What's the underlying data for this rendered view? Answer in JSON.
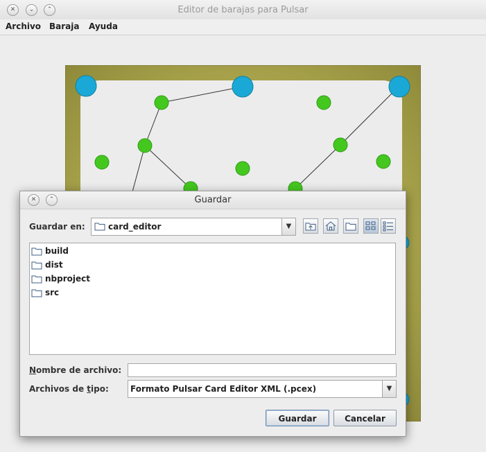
{
  "window": {
    "title": "Editor de barajas para Pulsar",
    "controls": [
      "close-icon",
      "minimize-icon",
      "maximize-icon"
    ]
  },
  "menubar": {
    "items": [
      {
        "label": "Archivo"
      },
      {
        "label": "Baraja"
      },
      {
        "label": "Ayuda"
      }
    ]
  },
  "card": {
    "colors": {
      "border": "#8f8a3a",
      "panel": "#ececec",
      "large_node": "#1aa9d6",
      "small_node": "#44c820"
    }
  },
  "dialog": {
    "title": "Guardar",
    "save_in_label": "Guardar en:",
    "current_folder": "card_editor",
    "toolbar_icons": [
      "up-folder-icon",
      "home-icon",
      "new-folder-icon",
      "list-view-icon",
      "details-view-icon"
    ],
    "files": [
      {
        "name": "build"
      },
      {
        "name": "dist"
      },
      {
        "name": "nbproject"
      },
      {
        "name": "src"
      }
    ],
    "filename_label_first": "N",
    "filename_label_rest": "ombre de archivo:",
    "filename_value": "",
    "filetype_label_pre": "Archivos de ",
    "filetype_label_u": "t",
    "filetype_label_post": "ipo:",
    "filetype_value": "Formato Pulsar Card Editor XML (.pcex)",
    "save_button": "Guardar",
    "cancel_button": "Cancelar"
  }
}
